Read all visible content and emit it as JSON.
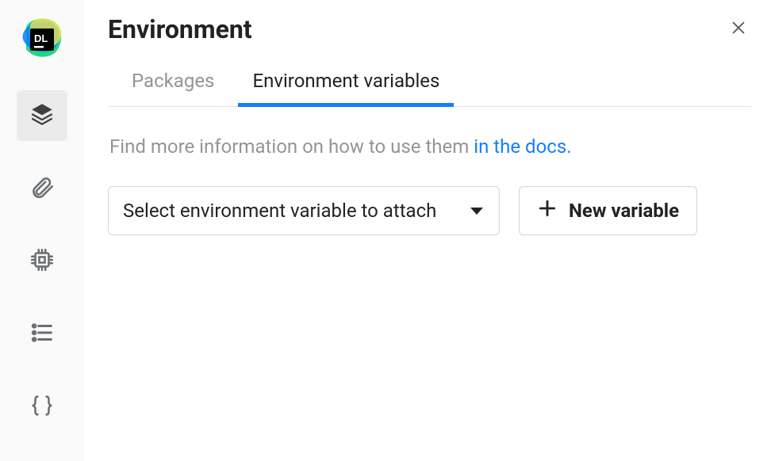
{
  "page": {
    "title": "Environment"
  },
  "tabs": {
    "packages": {
      "label": "Packages"
    },
    "environment_variables": {
      "label": "Environment variables"
    }
  },
  "info": {
    "prefix": "Find more information on how to use them ",
    "link_text": "in the docs.",
    "link_href": "#"
  },
  "controls": {
    "select_placeholder": "Select environment variable to attach",
    "new_variable_label": "New variable"
  },
  "sidebar": {
    "items": [
      {
        "name": "environment-nav",
        "active": true
      },
      {
        "name": "attachments-nav",
        "active": false
      },
      {
        "name": "compute-nav",
        "active": false
      },
      {
        "name": "outline-nav",
        "active": false
      },
      {
        "name": "code-nav",
        "active": false
      }
    ]
  }
}
